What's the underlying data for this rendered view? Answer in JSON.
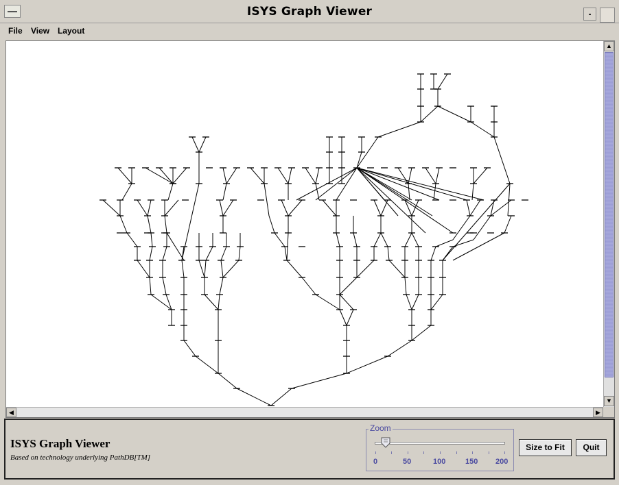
{
  "window": {
    "title": "ISYS Graph Viewer"
  },
  "menu": {
    "items": [
      {
        "label": "File",
        "key": "file"
      },
      {
        "label": "View",
        "key": "view"
      },
      {
        "label": "Layout",
        "key": "layout"
      }
    ]
  },
  "panel": {
    "title": "ISYS Graph Viewer",
    "subtitle": "Based on technology underlying PathDB[TM]"
  },
  "zoom": {
    "label": "Zoom",
    "value": 10,
    "min": 0,
    "max": 200,
    "ticks": [
      "0",
      "50",
      "100",
      "150",
      "200"
    ]
  },
  "buttons": {
    "size_to_fit": "Size to Fit",
    "quit": "Quit"
  },
  "graph": {
    "node_count": "many",
    "colors": {
      "edge": "#000000",
      "background": "#ffffff",
      "scroll_thumb": "#a6a8dc",
      "accent": "#4a4aa0"
    }
  }
}
